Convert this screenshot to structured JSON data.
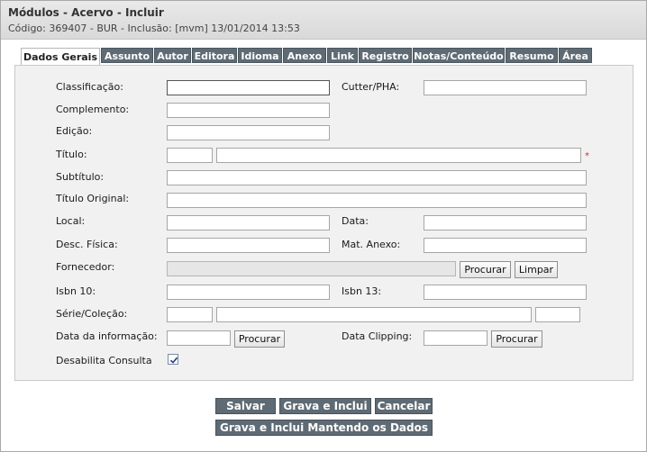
{
  "header": {
    "title": "Módulos - Acervo - Incluir",
    "subtitle": "Código: 369407 - BUR - Inclusão: [mvm] 13/01/2014 13:53"
  },
  "tabs": [
    {
      "label": "Dados Gerais",
      "active": true
    },
    {
      "label": "Assunto"
    },
    {
      "label": "Autor"
    },
    {
      "label": "Editora"
    },
    {
      "label": "Idioma"
    },
    {
      "label": "Anexo"
    },
    {
      "label": "Link"
    },
    {
      "label": "Registro"
    },
    {
      "label": "Notas/Conteúdo"
    },
    {
      "label": "Resumo"
    },
    {
      "label": "Área"
    }
  ],
  "form": {
    "classificacao": "Classificação:",
    "cutter": "Cutter/PHA:",
    "complemento": "Complemento:",
    "edicao": "Edição:",
    "titulo": "Título:",
    "required_mark": "*",
    "subtitulo": "Subtítulo:",
    "titulo_original": "Título Original:",
    "local": "Local:",
    "data": "Data:",
    "desc_fisica": "Desc. Física:",
    "mat_anexo": "Mat. Anexo:",
    "fornecedor": "Fornecedor:",
    "procurar": "Procurar",
    "limpar": "Limpar",
    "isbn10": "Isbn 10:",
    "isbn13": "Isbn 13:",
    "serie": "Série/Coleção:",
    "data_info": "Data da informação:",
    "data_clipping": "Data Clipping:",
    "desabilita": "Desabilita Consulta",
    "desabilita_checked": true
  },
  "actions": {
    "salvar": "Salvar",
    "grava_inclui": "Grava e Inclui",
    "cancelar": "Cancelar",
    "grava_inclui_mantendo": "Grava e Inclui Mantendo os Dados"
  },
  "colors": {
    "tab_bg": "#5f6b74",
    "panel_bg": "#f1f1f1",
    "required": "#d32f2f"
  }
}
